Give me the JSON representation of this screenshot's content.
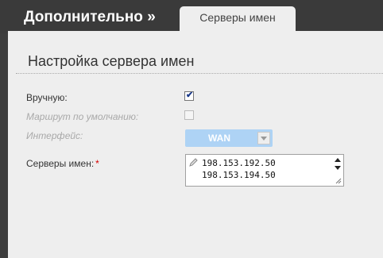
{
  "header": {
    "section_title": "Дополнительно »"
  },
  "tabs": [
    {
      "label": "Серверы имен",
      "active": true
    }
  ],
  "panel": {
    "heading": "Настройка сервера имен"
  },
  "form": {
    "manual": {
      "label": "Вручную:",
      "checked": true
    },
    "default_route": {
      "label": "Маршрут по умолчанию:",
      "checked": false,
      "disabled": true
    },
    "interface": {
      "label": "Интерфейс:",
      "value": "WAN",
      "disabled": true
    },
    "name_servers": {
      "label": "Серверы имен:",
      "required_mark": "*",
      "values": [
        "198.153.192.50",
        "198.153.194.50"
      ]
    }
  },
  "colors": {
    "page_bg": "#3c3c3c",
    "panel_bg": "#eeeeee",
    "select_bg": "#aed3f5",
    "required": "#d40000",
    "check": "#1b3a8a"
  },
  "icons": [
    "checkmark-icon",
    "chevron-down-icon",
    "pencil-icon",
    "scroll-up-icon",
    "scroll-down-icon",
    "resize-grip-icon"
  ]
}
